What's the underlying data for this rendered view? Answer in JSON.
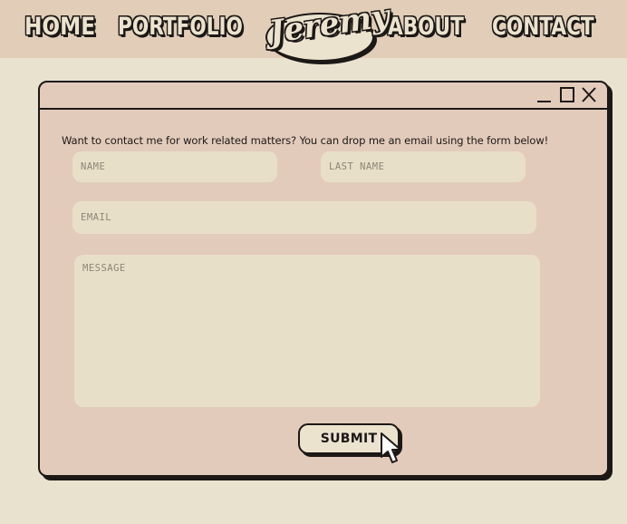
{
  "nav": {
    "home": "HOME",
    "portfolio": "PORTFOLIO",
    "logo": "Jeremy",
    "about": "ABOUT",
    "contact": "CONTACT"
  },
  "window": {
    "controls": [
      "minimize-icon",
      "maximize-icon",
      "close-icon"
    ],
    "intro": "Want to contact me for work related matters? You can drop me an email using the form below!"
  },
  "form": {
    "name_placeholder": "NAME",
    "last_name_placeholder": "LAST NAME",
    "email_placeholder": "EMAIL",
    "message_placeholder": "MESSAGE",
    "submit_label": "SUBMIT"
  },
  "colors": {
    "page_background": "#e9e2cf",
    "nav_band": "#e2cdb8",
    "window_fill": "#e3cbbb",
    "field_fill": "#e8dfc8",
    "outline": "#1c1816"
  }
}
